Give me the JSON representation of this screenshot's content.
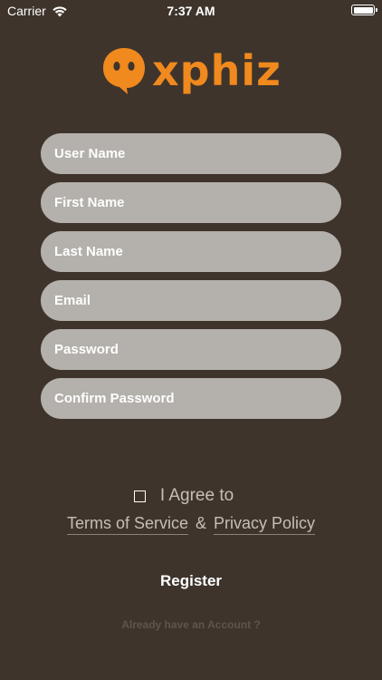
{
  "status_bar": {
    "carrier": "Carrier",
    "time": "7:37 AM",
    "wifi_icon": "wifi-icon",
    "battery_icon": "battery-icon"
  },
  "logo": {
    "text": "xphiz",
    "icon": "chat-bubble-face-icon",
    "color": "#f0891e"
  },
  "form": {
    "username_placeholder": "User Name",
    "username_value": "",
    "first_name_placeholder": "First Name",
    "first_name_value": "",
    "last_name_placeholder": "Last Name",
    "last_name_value": "",
    "email_placeholder": "Email",
    "email_value": "",
    "password_placeholder": "Password",
    "password_value": "",
    "confirm_password_placeholder": "Confirm Password",
    "confirm_password_value": ""
  },
  "agreement": {
    "checked": false,
    "label": "I Agree to",
    "terms_link": "Terms of Service",
    "separator": "&",
    "privacy_link": "Privacy Policy"
  },
  "actions": {
    "register_label": "Register",
    "login_link": "Already have an Account ?"
  },
  "colors": {
    "background": "#3e342c",
    "field_background": "#b4b0ab",
    "accent": "#f0891e"
  }
}
